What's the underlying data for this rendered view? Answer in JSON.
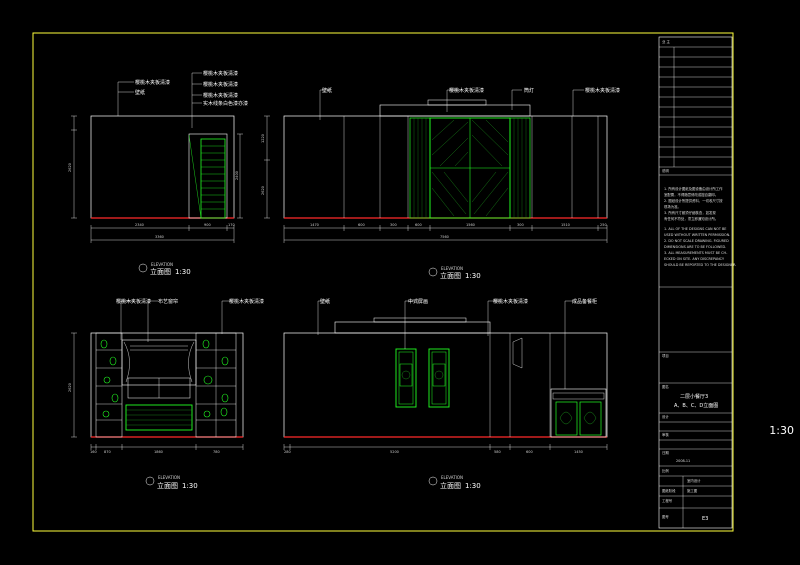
{
  "zoom": "1:30",
  "elevations": [
    {
      "title": "立面图",
      "subtitle": "ELEVATION",
      "scale": "1:30",
      "notes": [
        "樱桃木夹板清漆",
        "樱桃木夹板清漆",
        "樱桃木夹板清漆",
        "实木线条白色漆亦漆",
        "壁纸"
      ],
      "dims_bottom": [
        "2340",
        "900",
        "170",
        "3360"
      ],
      "dims_side": [
        "2400",
        "2620"
      ]
    },
    {
      "title": "立面图",
      "subtitle": "ELEVATION",
      "scale": "1:30",
      "notes": [
        "壁纸",
        "樱桃木夹板清漆",
        "筒灯",
        "樱桃木夹板清漆"
      ],
      "dims_bottom": [
        "1470",
        "600",
        "300",
        "600",
        "1560",
        "300",
        "1510",
        "250",
        "7560"
      ],
      "dims_side": [
        "1220",
        "2620"
      ]
    },
    {
      "title": "立面图",
      "subtitle": "ELEVATION",
      "scale": "1:30",
      "notes": [
        "樱桃木夹板清漆",
        "布艺窗帘",
        "樱桃木夹板清漆"
      ],
      "dims_bottom": [
        "160",
        "870",
        "1860",
        "780"
      ],
      "dims_side": [
        "2620"
      ]
    },
    {
      "title": "立面图",
      "subtitle": "ELEVATION",
      "scale": "1:30",
      "notes": [
        "壁纸",
        "中式屏画",
        "樱桃木夹板清漆",
        "成品备餐柜"
      ],
      "dims_bottom": [
        "280",
        "5200",
        "580",
        "600",
        "1450"
      ],
      "dims_side": [
        "2620"
      ]
    }
  ],
  "title_block": {
    "top_label": "业 主",
    "notes_label": "说明",
    "notes_cn": [
      "1. 所有设计图纸及图设备由设计所工作",
      "   室配置，不得随意修改或擅自翻印。",
      "2. 图纸设计所提供资料，一切收尺寸按",
      "   现场为准。",
      "3. 所有尺寸都须仔细核查，如发现",
      "   有任何不符处，须立即通知设计所。"
    ],
    "notes_en": [
      "1. ALL OF THE DESIGNS CAN NOT BE",
      "USED WITHOUT WRITTEN PERMISSION.",
      "2. DO NOT SCALE DRAWING. FIGURED",
      "DIMENSIONS ARE TO BE FOLLOWED.",
      "3. ALL MEASUREMENTS MUST BE CH-",
      "ECKED ON SITE. ANY DISCREPANCY",
      "SHOULD BE REPORTED TO THE DESIGNER."
    ],
    "project_label": "项目",
    "drawing_label": "图名",
    "drawing_name_1": "二层小餐厅3",
    "drawing_name_2": "A、B、C、D立面图",
    "designer_label": "设计",
    "check_label": "审核",
    "date_label": "日期",
    "date": "2008-11",
    "scale_label": "比例",
    "type_label": "室内设计",
    "stage_label": "图纸阶段",
    "stage": "施工图",
    "job_label": "工程号",
    "sheet_label": "图号",
    "sheet": "E3"
  }
}
